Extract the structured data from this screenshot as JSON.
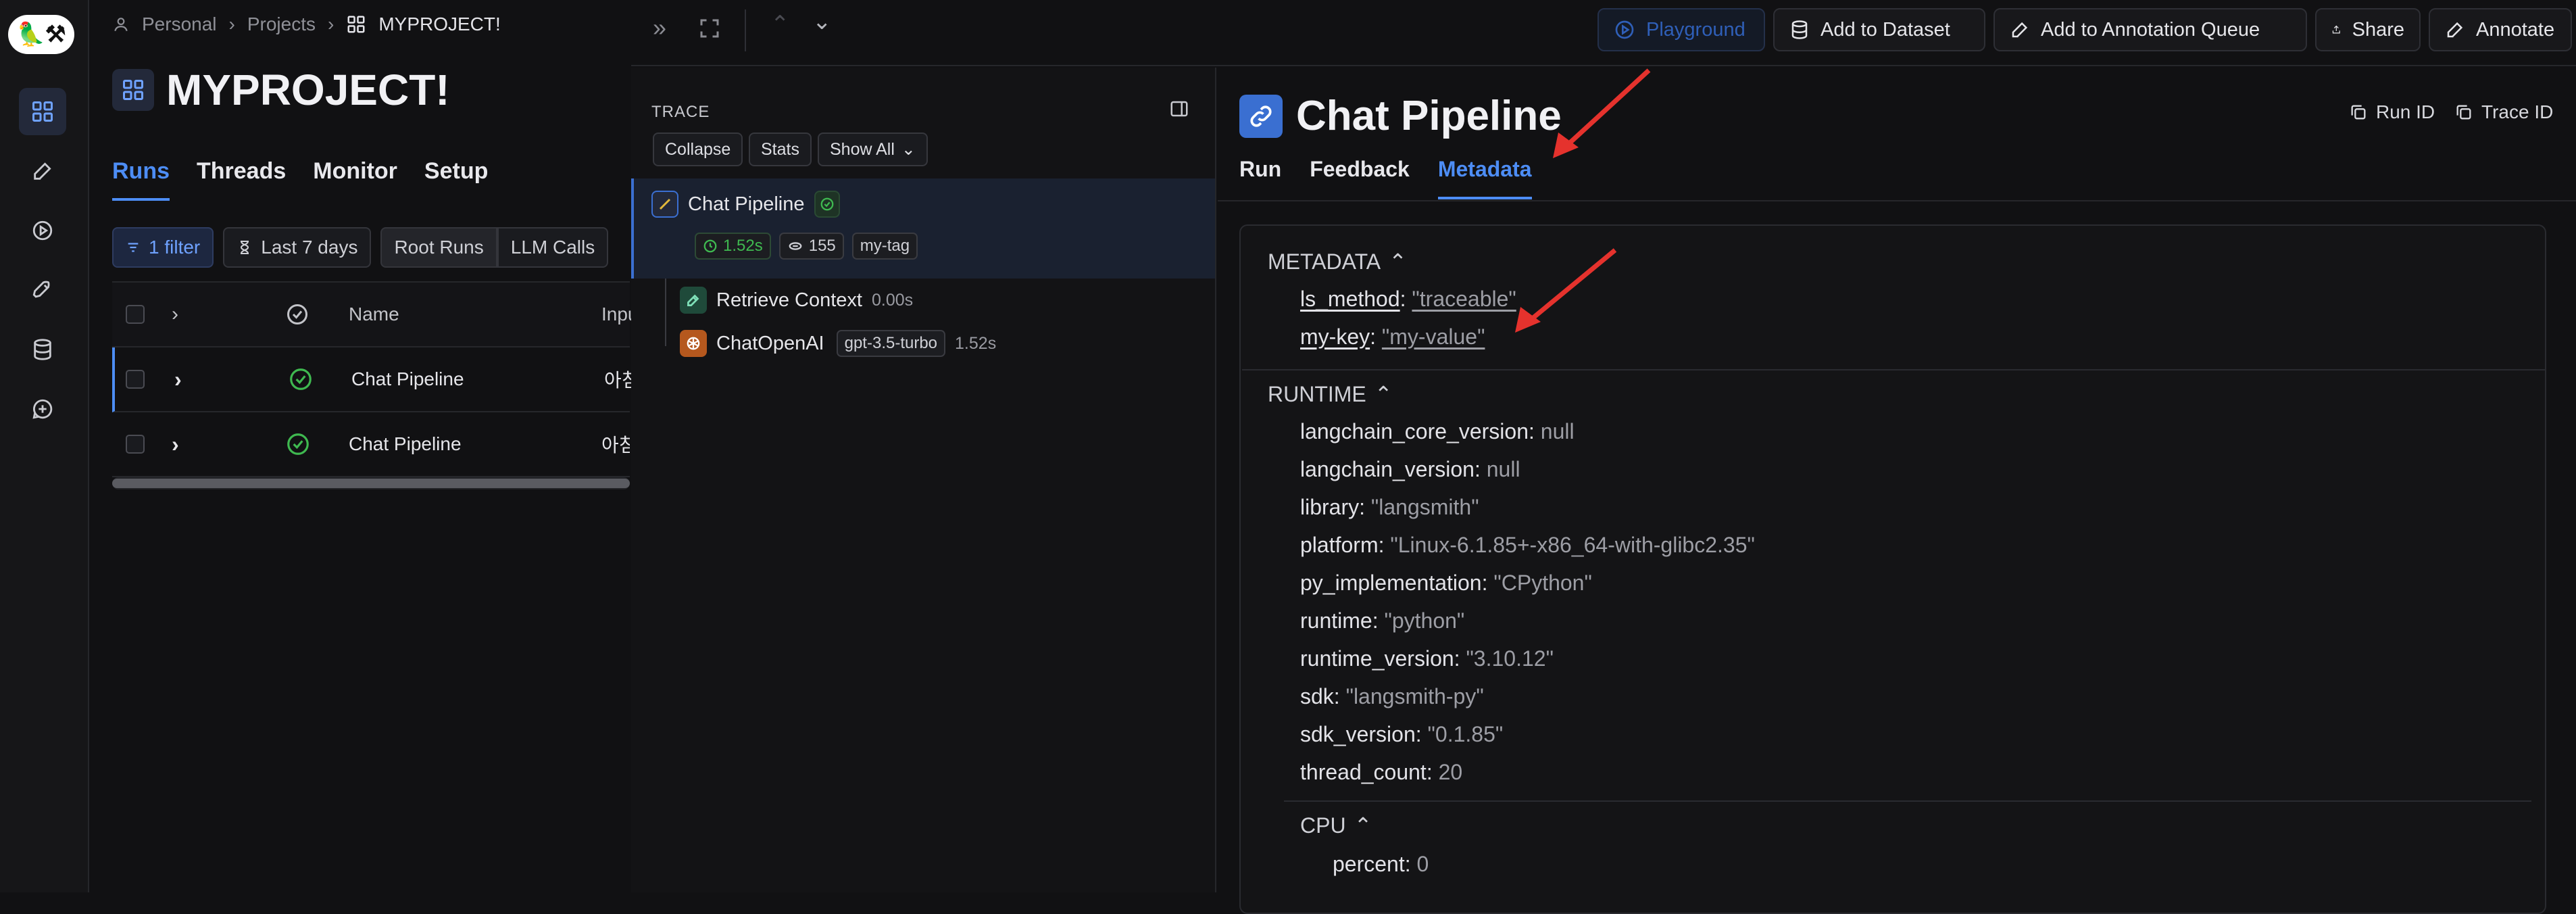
{
  "logo": {
    "text": "🦜⚒"
  },
  "breadcrumb": {
    "personal": "Personal",
    "projects": "Projects",
    "current": "MYPROJECT!"
  },
  "project": {
    "title": "MYPROJECT!"
  },
  "project_tabs": [
    "Runs",
    "Threads",
    "Monitor",
    "Setup"
  ],
  "filters": {
    "filter": "1 filter",
    "date": "Last 7 days",
    "root_runs": "Root Runs",
    "llm_calls": "LLM Calls"
  },
  "table": {
    "columns": {
      "name": "Name",
      "input": "Input"
    },
    "rows": [
      {
        "name": "Chat Pipeline",
        "input": "아침에"
      },
      {
        "name": "Chat Pipeline",
        "input": "아침에"
      }
    ]
  },
  "topbar": {
    "playground": "Playground",
    "add_dataset": "Add to Dataset",
    "add_queue": "Add to Annotation Queue",
    "share": "Share",
    "annotate": "Annotate"
  },
  "trace": {
    "label": "TRACE",
    "collapse": "Collapse",
    "stats": "Stats",
    "show_all": "Show All",
    "root": {
      "name": "Chat Pipeline",
      "latency": "1.52s",
      "tokens": "155",
      "tag": "my-tag"
    },
    "children": [
      {
        "name": "Retrieve Context",
        "latency": "0.00s"
      },
      {
        "name": "ChatOpenAI",
        "model": "gpt-3.5-turbo",
        "latency": "1.52s"
      }
    ]
  },
  "detail": {
    "title": "Chat Pipeline",
    "run_id": "Run ID",
    "trace_id": "Trace ID",
    "tabs": [
      "Run",
      "Feedback",
      "Metadata"
    ],
    "metadata_header": "METADATA",
    "metadata": [
      {
        "key": "ls_method",
        "value": "\"traceable\""
      },
      {
        "key": "my-key",
        "value": "\"my-value\""
      }
    ],
    "runtime_header": "RUNTIME",
    "runtime": [
      {
        "key": "langchain_core_version",
        "value": "null"
      },
      {
        "key": "langchain_version",
        "value": "null"
      },
      {
        "key": "library",
        "value": "\"langsmith\""
      },
      {
        "key": "platform",
        "value": "\"Linux-6.1.85+-x86_64-with-glibc2.35\""
      },
      {
        "key": "py_implementation",
        "value": "\"CPython\""
      },
      {
        "key": "runtime",
        "value": "\"python\""
      },
      {
        "key": "runtime_version",
        "value": "\"3.10.12\""
      },
      {
        "key": "sdk",
        "value": "\"langsmith-py\""
      },
      {
        "key": "sdk_version",
        "value": "\"0.1.85\""
      },
      {
        "key": "thread_count",
        "value": "20"
      }
    ],
    "cpu_header": "CPU",
    "cpu": [
      {
        "key": "percent",
        "value": "0"
      }
    ]
  },
  "colors": {
    "accent": "#4d8df5",
    "success": "#3fb950",
    "annotation_arrow": "#e5322d"
  }
}
